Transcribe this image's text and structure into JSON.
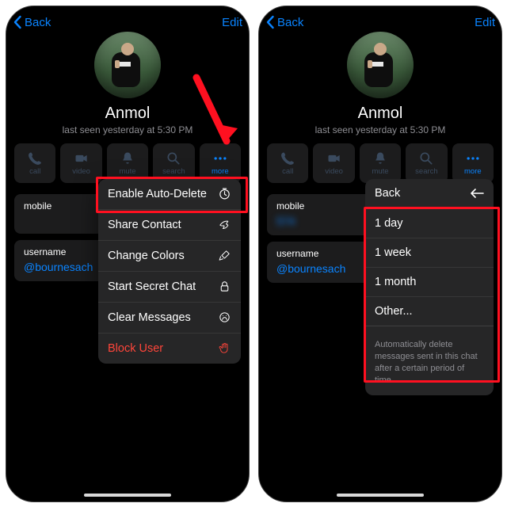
{
  "nav": {
    "back": "Back",
    "edit": "Edit"
  },
  "profile": {
    "name": "Anmol",
    "last_seen": "last seen yesterday at 5:30 PM"
  },
  "actions": {
    "call": "call",
    "video": "video",
    "mute": "mute",
    "search": "search",
    "more": "more"
  },
  "info": {
    "mobile_label": "mobile",
    "mobile_value_left": "",
    "mobile_value_right": "574",
    "username_label": "username",
    "username_value": "@bournesach"
  },
  "more_menu": {
    "autodelete": "Enable Auto-Delete",
    "share": "Share Contact",
    "colors": "Change Colors",
    "secret": "Start Secret Chat",
    "clear": "Clear Messages",
    "block": "Block User"
  },
  "autodelete_panel": {
    "back": "Back",
    "opt1": "1 day",
    "opt2": "1 week",
    "opt3": "1 month",
    "opt4": "Other...",
    "desc": "Automatically delete messages sent in this chat after a certain period of time."
  }
}
